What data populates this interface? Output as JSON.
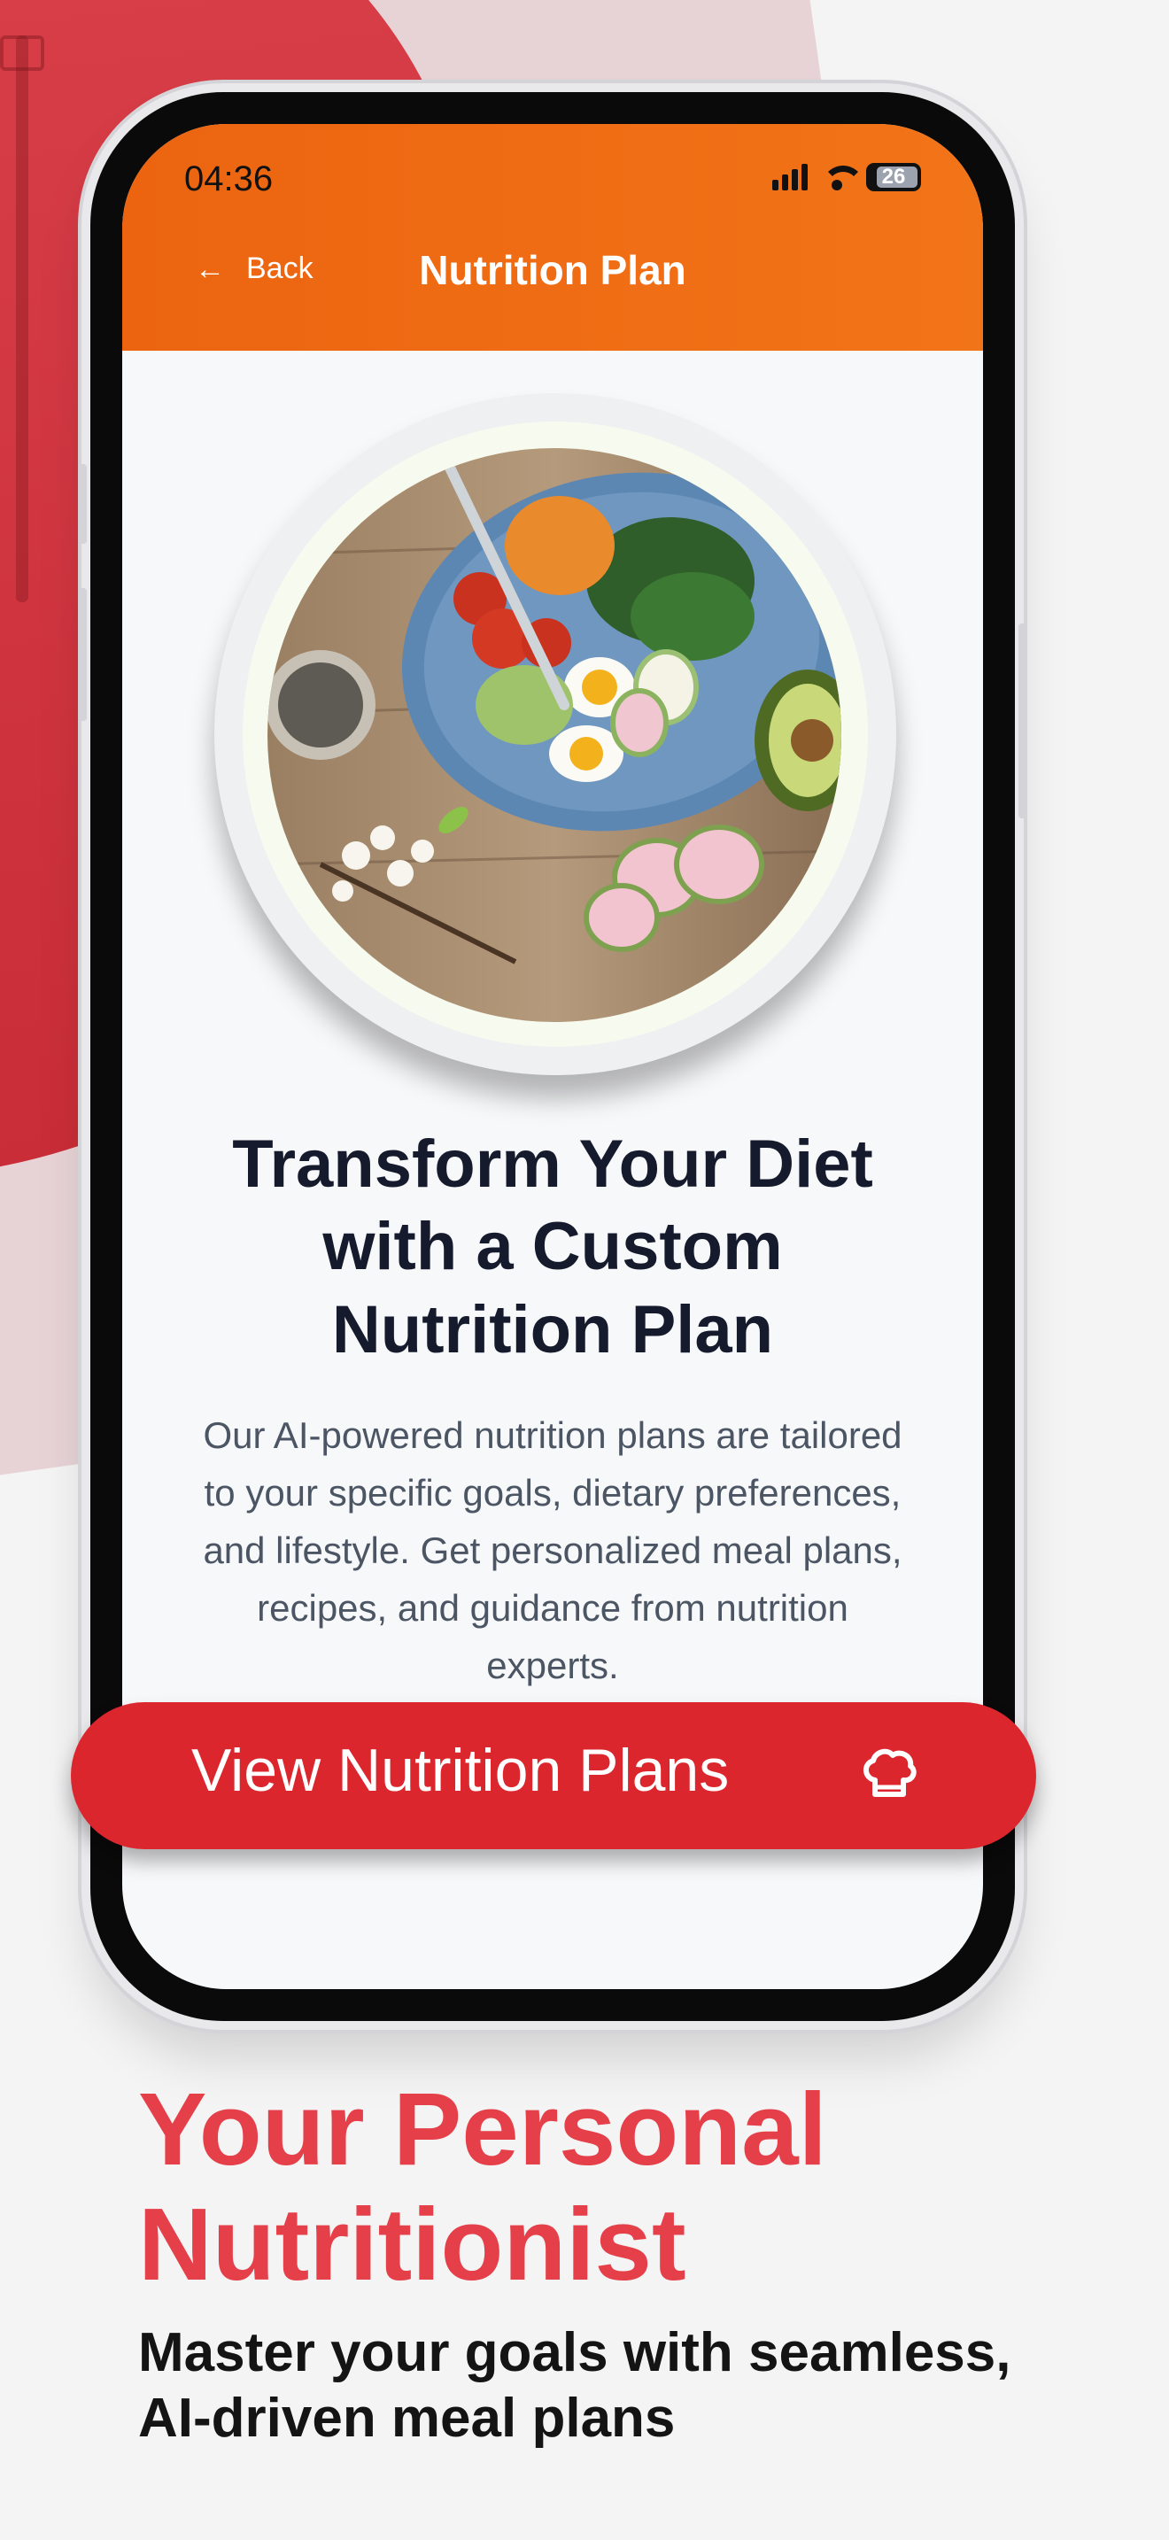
{
  "status_bar": {
    "time": "04:36",
    "battery": "26"
  },
  "header": {
    "back_label": "Back",
    "title": "Nutrition Plan",
    "accent": "#F06A14"
  },
  "content": {
    "headline": "Transform Your Diet with a Custom Nutrition Plan",
    "description": "Our AI-powered nutrition plans are tailored to your specific goals, dietary preferences, and lifestyle. Get personalized meal plans, recipes, and guidance from nutrition experts.",
    "cta_label": "View Nutrition Plans",
    "cta_icon": "chef-hat-icon",
    "cta_color": "#DC262E"
  },
  "marketing": {
    "tagline": "Your Personal Nutritionist",
    "subtagline": "Master your goals with seamless, AI-driven meal plans",
    "tagline_color": "#E5404A"
  }
}
